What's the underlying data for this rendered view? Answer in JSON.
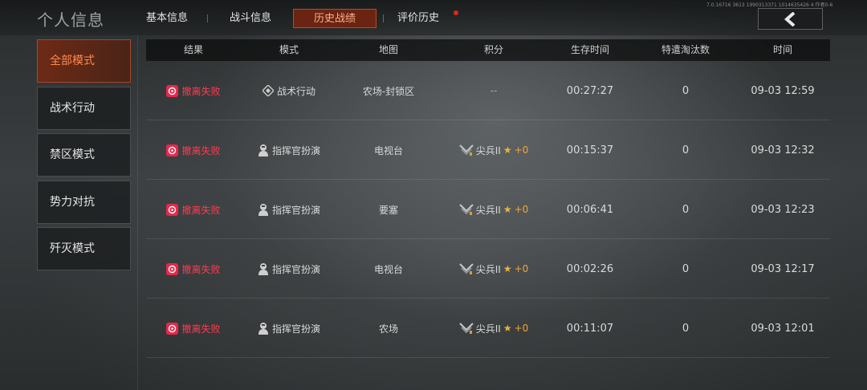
{
  "header": {
    "title": "个人信息",
    "tabs": [
      {
        "label": "基本信息"
      },
      {
        "label": "战斗信息"
      },
      {
        "label": "历史战绩",
        "active": true
      },
      {
        "label": "评价历史"
      }
    ],
    "version_text": "7.0.16716 3613 1990313371 1014635426 4  作者0-6",
    "back_icon": "chevron-left-icon",
    "accent": "#c0461f"
  },
  "sidebar": {
    "items": [
      {
        "label": "全部模式",
        "active": true
      },
      {
        "label": "战术行动"
      },
      {
        "label": "禁区模式"
      },
      {
        "label": "势力对抗"
      },
      {
        "label": "歼灭模式"
      }
    ]
  },
  "table": {
    "columns": [
      "结果",
      "模式",
      "地图",
      "积分",
      "生存时间",
      "特遣淘汰数",
      "时间"
    ],
    "rows": [
      {
        "result": "撤离失败",
        "mode": "战术行动",
        "mode_icon": "diamond-icon",
        "map": "农场-封锁区",
        "score": "--",
        "survival": "00:27:27",
        "kills": "0",
        "time": "09-03 12:59"
      },
      {
        "result": "撤离失败",
        "mode": "指挥官扮演",
        "mode_icon": "commander-icon",
        "map": "电视台",
        "rank": "尖兵II",
        "plus": "+0",
        "survival": "00:15:37",
        "kills": "0",
        "time": "09-03 12:32"
      },
      {
        "result": "撤离失败",
        "mode": "指挥官扮演",
        "mode_icon": "commander-icon",
        "map": "要塞",
        "rank": "尖兵II",
        "plus": "+0",
        "survival": "00:06:41",
        "kills": "0",
        "time": "09-03 12:23"
      },
      {
        "result": "撤离失败",
        "mode": "指挥官扮演",
        "mode_icon": "commander-icon",
        "map": "电视台",
        "rank": "尖兵II",
        "plus": "+0",
        "survival": "00:02:26",
        "kills": "0",
        "time": "09-03 12:17"
      },
      {
        "result": "撤离失败",
        "mode": "指挥官扮演",
        "mode_icon": "commander-icon",
        "map": "农场",
        "rank": "尖兵II",
        "plus": "+0",
        "survival": "00:11:07",
        "kills": "0",
        "time": "09-03 12:01"
      }
    ],
    "result_color": "#ff3a4f"
  }
}
